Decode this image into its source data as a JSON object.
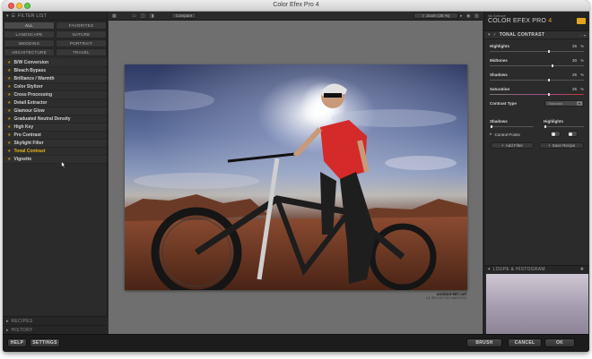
{
  "window": {
    "title": "Color Efex Pro 4"
  },
  "left_panel": {
    "header": "FILTER LIST",
    "categories": [
      "ALL",
      "FAVORITES",
      "LANDSCAPE",
      "NATURE",
      "WEDDING",
      "PORTRAIT",
      "ARCHITECTURE",
      "TRAVEL"
    ],
    "filters": [
      "B/W Conversion",
      "Bleach Bypass",
      "Brilliance / Warmth",
      "Color Stylizer",
      "Cross Processing",
      "Detail Extractor",
      "Glamour Glow",
      "Graduated Neutral Density",
      "High Key",
      "Pro Contrast",
      "Skylight Filter",
      "Tonal Contrast",
      "Vignette"
    ],
    "active_filter": "Tonal Contrast",
    "recipes_label": "RECIPES",
    "history_label": "HISTORY"
  },
  "toolbar": {
    "compare_label": "Compare",
    "zoom_label": "Zoom (25 %)"
  },
  "canvas": {
    "filename": "untitled-987.nef",
    "meta": "1/1 ISO 100 F/8.0 NIKON D3"
  },
  "right_panel": {
    "company": "Nik Software",
    "product": "COLOR EFEX PRO",
    "version": "4",
    "filter_name": "TONAL CONTRAST",
    "controls": [
      {
        "label": "Highlights",
        "value": "25",
        "unit": "%",
        "level": 0.62
      },
      {
        "label": "Midtones",
        "value": "30",
        "unit": "%",
        "level": 0.66
      },
      {
        "label": "Shadows",
        "value": "25",
        "unit": "%",
        "level": 0.62
      },
      {
        "label": "Saturation",
        "value": "25",
        "unit": "%",
        "level": 0.62
      }
    ],
    "contrast_type_label": "Contrast Type",
    "contrast_type_value": "Standard",
    "shadows_label": "Shadows",
    "highlights_label": "Highlights",
    "control_points_label": "Control Points",
    "add_filter_label": "Add Filter",
    "save_recipe_label": "Save Recipe",
    "loupe_label": "LOUPE & HISTOGRAM"
  },
  "bottom_bar": {
    "help_label": "HELP",
    "settings_label": "SETTINGS",
    "brush_label": "BRUSH",
    "cancel_label": "CANCEL",
    "ok_label": "OK"
  },
  "colors": {
    "accent": "#e8b21a",
    "panel": "#2b2b2b",
    "canvas": "#6f6f6f"
  }
}
